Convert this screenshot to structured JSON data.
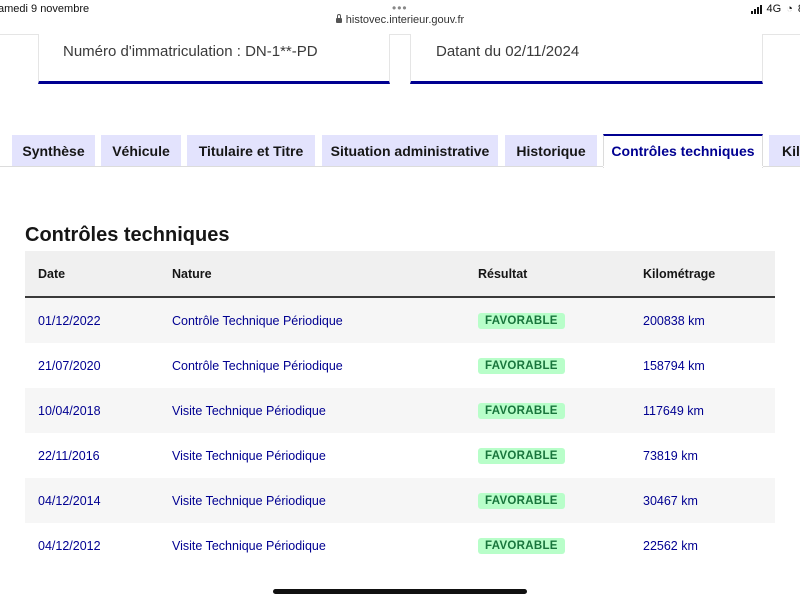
{
  "status_bar": {
    "date": "amedi 9 novembre",
    "network": "4G",
    "battery_partial": "8",
    "url": "histovec.interieur.gouv.fr",
    "browser_dots": "•••"
  },
  "cards": {
    "registration": "Numéro d'immatriculation : DN-1**-PD",
    "dated": "Datant du 02/11/2024"
  },
  "tabs": [
    {
      "label": "Synthèse",
      "active": false
    },
    {
      "label": "Véhicule",
      "active": false
    },
    {
      "label": "Titulaire et Titre",
      "active": false
    },
    {
      "label": "Situation administrative",
      "active": false
    },
    {
      "label": "Historique",
      "active": false
    },
    {
      "label": "Contrôles techniques",
      "active": true
    },
    {
      "label": "Kilo",
      "active": false
    }
  ],
  "section_title": "Contrôles techniques",
  "table": {
    "headers": {
      "date": "Date",
      "nature": "Nature",
      "result": "Résultat",
      "mileage": "Kilométrage"
    },
    "rows": [
      {
        "date": "01/12/2022",
        "nature": "Contrôle Technique Périodique",
        "result": "FAVORABLE",
        "mileage": "200838 km"
      },
      {
        "date": "21/07/2020",
        "nature": "Contrôle Technique Périodique",
        "result": "FAVORABLE",
        "mileage": "158794 km"
      },
      {
        "date": "10/04/2018",
        "nature": "Visite Technique Périodique",
        "result": "FAVORABLE",
        "mileage": "117649 km"
      },
      {
        "date": "22/11/2016",
        "nature": "Visite Technique Périodique",
        "result": "FAVORABLE",
        "mileage": "73819 km"
      },
      {
        "date": "04/12/2014",
        "nature": "Visite Technique Périodique",
        "result": "FAVORABLE",
        "mileage": "30467 km"
      },
      {
        "date": "04/12/2012",
        "nature": "Visite Technique Périodique",
        "result": "FAVORABLE",
        "mileage": "22562 km"
      }
    ]
  },
  "colors": {
    "accent_blue": "#000091",
    "tab_bg": "#e3e3fd",
    "badge_bg": "#b8fec9",
    "badge_text": "#18753c"
  }
}
